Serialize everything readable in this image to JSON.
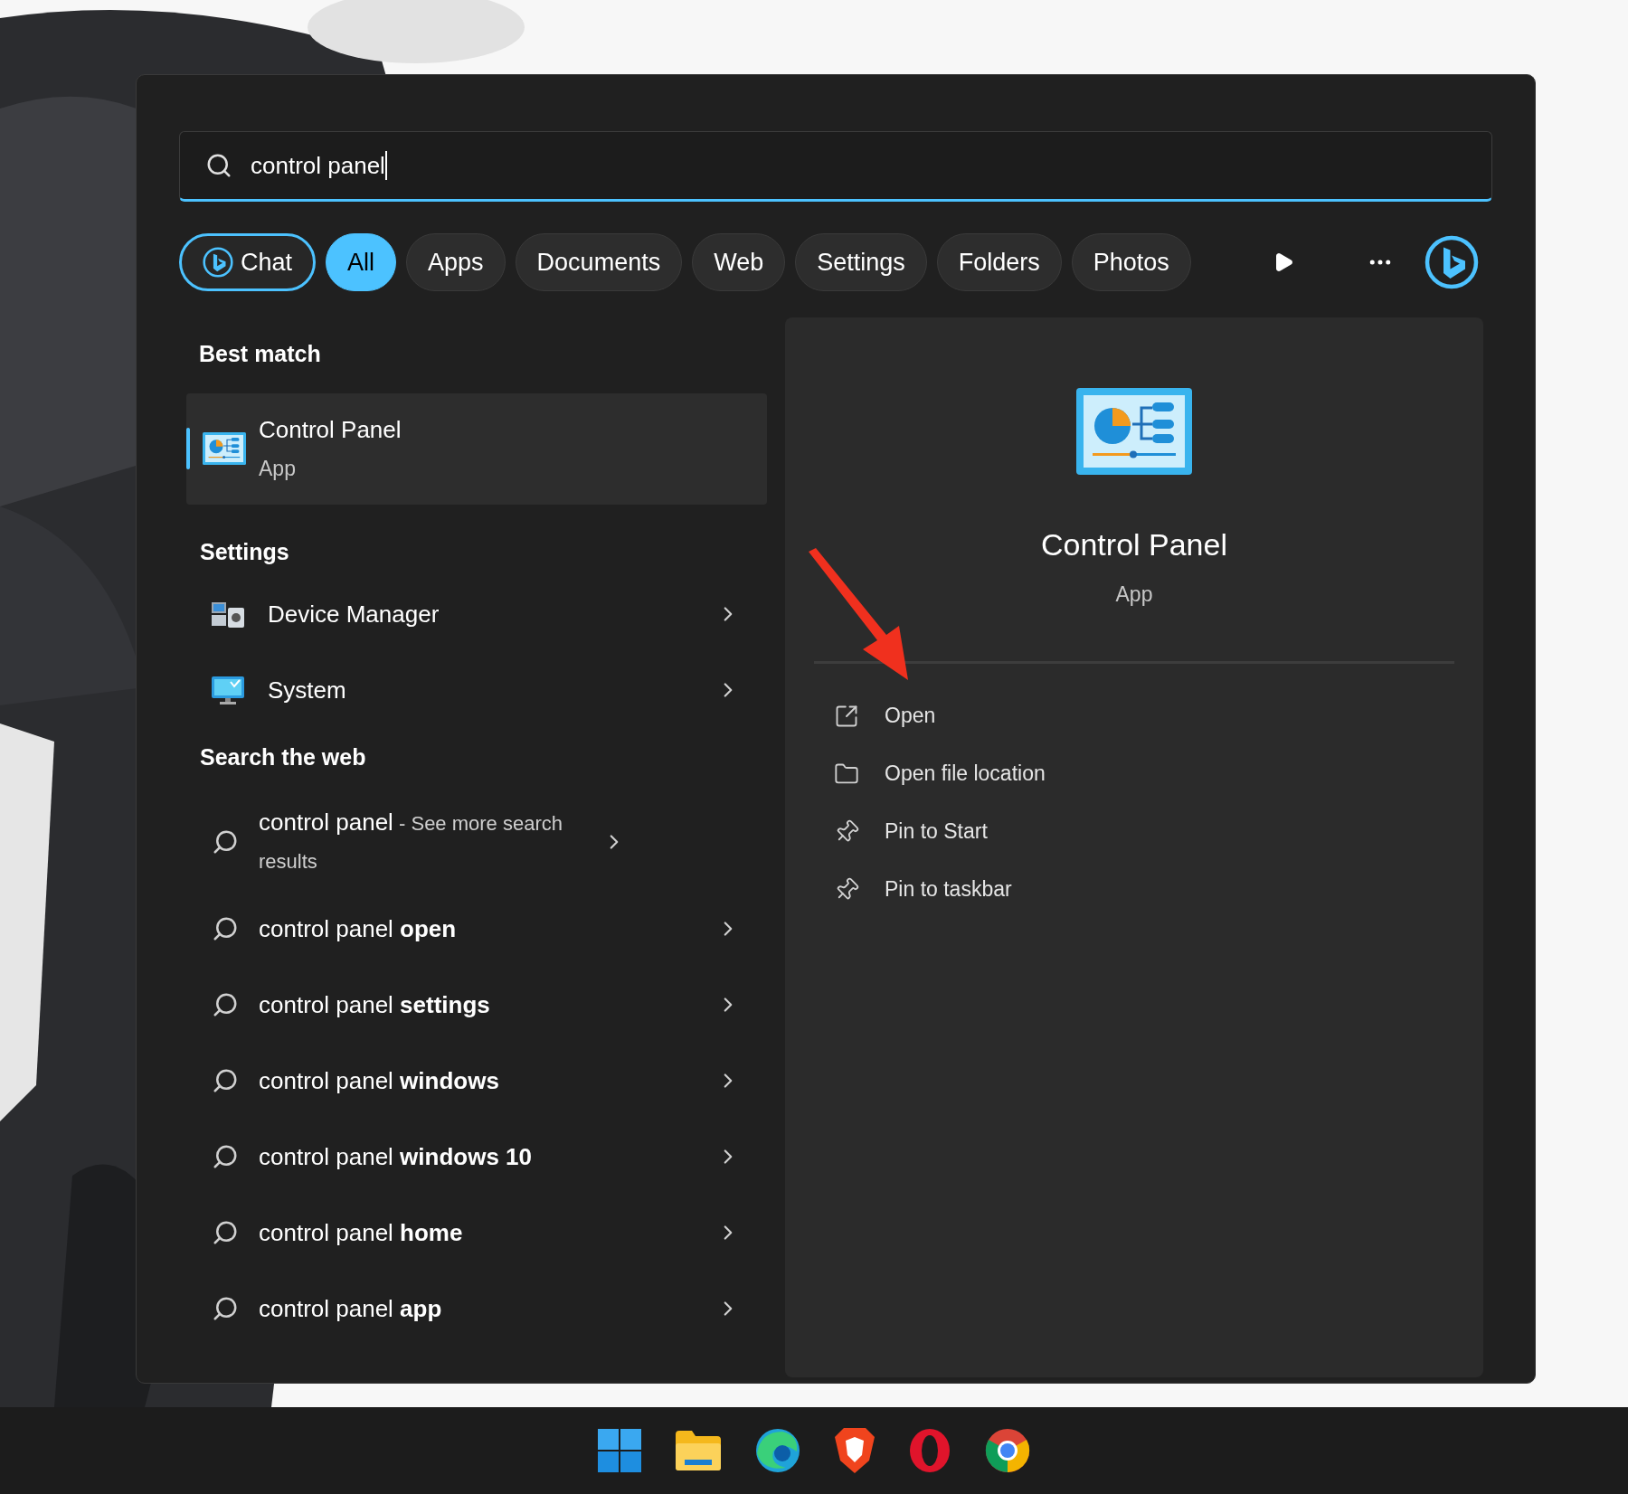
{
  "search": {
    "value": "control panel"
  },
  "filters": [
    {
      "label": "Chat",
      "kind": "chat",
      "selected": false
    },
    {
      "label": "All",
      "kind": "plain",
      "selected": true
    },
    {
      "label": "Apps",
      "kind": "plain",
      "selected": false
    },
    {
      "label": "Documents",
      "kind": "plain",
      "selected": false
    },
    {
      "label": "Web",
      "kind": "plain",
      "selected": false
    },
    {
      "label": "Settings",
      "kind": "plain",
      "selected": false
    },
    {
      "label": "Folders",
      "kind": "plain",
      "selected": false
    },
    {
      "label": "Photos",
      "kind": "plain",
      "selected": false
    }
  ],
  "best_match": {
    "heading": "Best match",
    "name": "Control Panel",
    "type": "App",
    "selected": true
  },
  "settings": {
    "heading": "Settings",
    "items": [
      {
        "label": "Device Manager",
        "kind": "device"
      },
      {
        "label": "System",
        "kind": "system"
      }
    ]
  },
  "web": {
    "heading": "Search the web",
    "items": [
      {
        "text": "control panel",
        "suffix": "- See more search results"
      },
      {
        "text": "control panel **open**"
      },
      {
        "text": "control panel **settings**"
      },
      {
        "text": "control panel **windows**"
      },
      {
        "text": "control panel **windows 10**"
      },
      {
        "text": "control panel **home**"
      },
      {
        "text": "control panel **app**"
      }
    ]
  },
  "preview": {
    "name": "Control Panel",
    "type": "App",
    "actions": [
      {
        "label": "Open",
        "kind": "open"
      },
      {
        "label": "Open file location",
        "kind": "folder"
      },
      {
        "label": "Pin to Start",
        "kind": "pin"
      },
      {
        "label": "Pin to taskbar",
        "kind": "pin"
      }
    ]
  }
}
